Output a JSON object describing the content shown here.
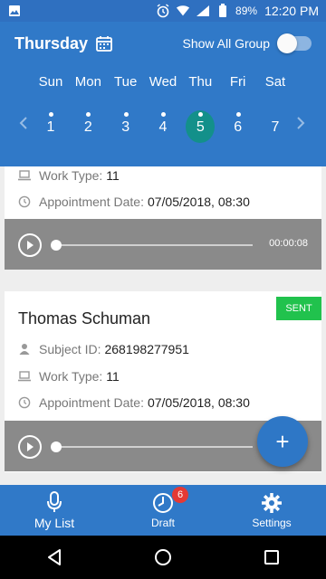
{
  "status_bar": {
    "battery": "89%",
    "time": "12:20 PM"
  },
  "header": {
    "day": "Thursday",
    "show_all_group_label": "Show All Group",
    "show_all_group_enabled": false,
    "weekdays": [
      "Sun",
      "Mon",
      "Tue",
      "Wed",
      "Thu",
      "Fri",
      "Sat"
    ],
    "dates": [
      "1",
      "2",
      "3",
      "4",
      "5",
      "6",
      "7"
    ],
    "selected_date": "5"
  },
  "cards": [
    {
      "work_type_label": "Work Type:",
      "work_type": "11",
      "appointment_label": "Appointment Date:",
      "appointment_date": "07/05/2018, 08:30",
      "duration": "00:00:08"
    },
    {
      "name": "Thomas Schuman",
      "status": "SENT",
      "subject_label": "Subject ID:",
      "subject_id": "268198277951",
      "work_type_label": "Work Type:",
      "work_type": "11",
      "appointment_label": "Appointment Date:",
      "appointment_date": "07/05/2018, 08:30"
    }
  ],
  "fab": {
    "label": "+"
  },
  "bottom_nav": {
    "items": [
      {
        "label": "My List",
        "icon": "microphone-icon",
        "active": true
      },
      {
        "label": "Draft",
        "icon": "clock-icon",
        "badge": "6"
      },
      {
        "label": "Settings",
        "icon": "gear-icon"
      }
    ]
  },
  "colors": {
    "primary": "#3079c8",
    "status_bar": "#2f70c0",
    "selected_date": "#13908a",
    "sent_badge": "#21c24d",
    "player": "#8a8a8a",
    "badge": "#e53935"
  }
}
